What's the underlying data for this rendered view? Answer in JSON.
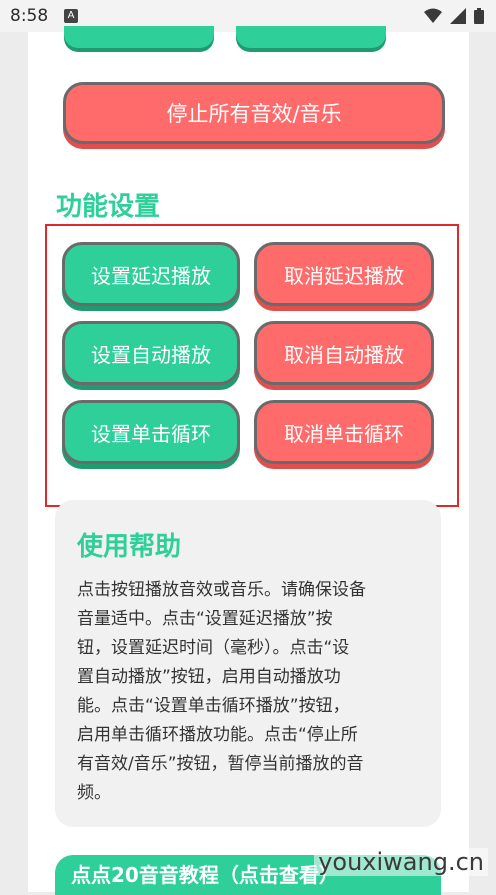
{
  "status_bar": {
    "time": "8:58",
    "notification_glyph": "A",
    "icons": [
      "wifi-icon",
      "signal-icon",
      "battery-icon"
    ]
  },
  "colors": {
    "accent_green": "#2ecf98",
    "accent_red": "#ff6b6b",
    "highlight_border": "#e0292b"
  },
  "sound_controls": {
    "stop_all_label": "停止所有音效/音乐"
  },
  "feature_settings": {
    "title": "功能设置",
    "buttons": [
      {
        "label": "设置延迟播放",
        "style": "green"
      },
      {
        "label": "取消延迟播放",
        "style": "red"
      },
      {
        "label": "设置自动播放",
        "style": "green"
      },
      {
        "label": "取消自动播放",
        "style": "red"
      },
      {
        "label": "设置单击循环",
        "style": "green"
      },
      {
        "label": "取消单击循环",
        "style": "red"
      }
    ]
  },
  "help": {
    "title": "使用帮助",
    "lines": [
      "点击按钮播放音效或音乐。请确保设备",
      "音量适中。点击“设置延迟播放”按",
      "钮，设置延迟时间（毫秒）。点击“设",
      "置自动播放”按钮，启用自动播放功",
      "能。点击“设置单击循环播放”按钮，",
      "启用单击循环播放功能。点击“停止所",
      "有音效/音乐”按钮，暂停当前播放的音",
      "频。"
    ]
  },
  "bottom_bar": {
    "label": "点点20音音教程（点击查看）"
  },
  "watermark": "youxiwang.cn"
}
